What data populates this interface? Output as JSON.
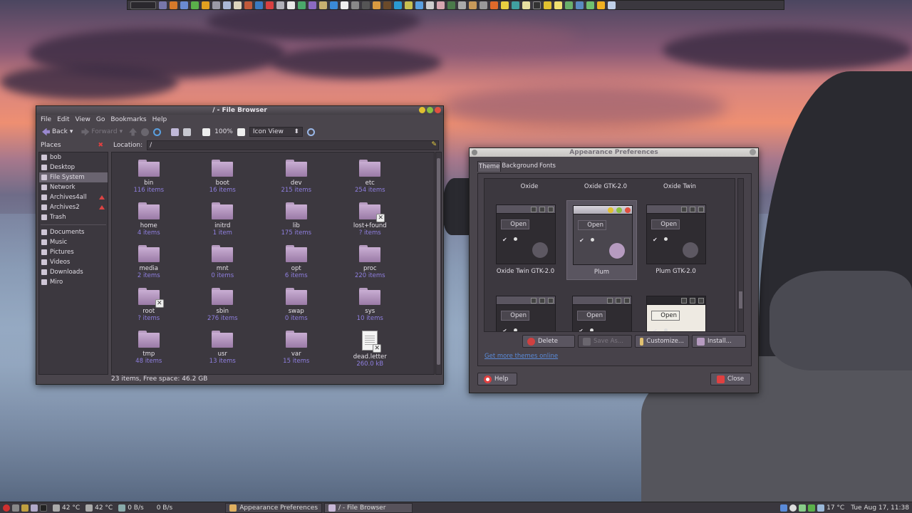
{
  "panel_top": {
    "launcher_icons": [
      "panel-menu-icon",
      "terminal-icon",
      "browser-icon",
      "mail-icon",
      "chat-icon",
      "music-icon",
      "settings-icon",
      "search-icon",
      "file-icon",
      "photo-icon",
      "video-icon",
      "game-icon",
      "calculator-icon",
      "calendar-icon",
      "network-icon",
      "chart-icon",
      "folder-icon",
      "trash-icon"
    ]
  },
  "file_browser": {
    "title": "/ - File Browser",
    "menus": [
      "File",
      "Edit",
      "View",
      "Go",
      "Bookmarks",
      "Help"
    ],
    "toolbar": {
      "back": "Back",
      "forward": "Forward",
      "zoom": "100%",
      "view_mode": "Icon View"
    },
    "places_label": "Places",
    "location_label": "Location:",
    "location_value": "/",
    "places": [
      {
        "label": "bob"
      },
      {
        "label": "Desktop"
      },
      {
        "label": "File System",
        "selected": true
      },
      {
        "label": "Network"
      },
      {
        "label": "Archives4all",
        "eject": true
      },
      {
        "label": "Archives2",
        "eject": true
      },
      {
        "label": "Trash"
      }
    ],
    "bookmarks": [
      {
        "label": "Documents"
      },
      {
        "label": "Music"
      },
      {
        "label": "Pictures"
      },
      {
        "label": "Videos"
      },
      {
        "label": "Downloads"
      },
      {
        "label": "Miro"
      }
    ],
    "items": [
      {
        "name": "bin",
        "info": "116 items"
      },
      {
        "name": "boot",
        "info": "16 items"
      },
      {
        "name": "dev",
        "info": "215 items"
      },
      {
        "name": "etc",
        "info": "254 items"
      },
      {
        "name": "home",
        "info": "4 items"
      },
      {
        "name": "initrd",
        "info": "1 item"
      },
      {
        "name": "lib",
        "info": "175 items"
      },
      {
        "name": "lost+found",
        "info": "? items"
      },
      {
        "name": "media",
        "info": "2 items"
      },
      {
        "name": "mnt",
        "info": "0 items"
      },
      {
        "name": "opt",
        "info": "6 items"
      },
      {
        "name": "proc",
        "info": "220 items"
      },
      {
        "name": "root",
        "info": "? items"
      },
      {
        "name": "sbin",
        "info": "276 items"
      },
      {
        "name": "swap",
        "info": "0 items"
      },
      {
        "name": "sys",
        "info": "10 items"
      },
      {
        "name": "tmp",
        "info": "48 items"
      },
      {
        "name": "usr",
        "info": "13 items"
      },
      {
        "name": "var",
        "info": "15 items"
      },
      {
        "name": "dead.letter",
        "info": "260.0 kB"
      }
    ],
    "status": "23 items, Free space: 46.2 GB"
  },
  "appearance": {
    "title": "Appearance Preferences",
    "tabs": [
      "Theme",
      "Background",
      "Fonts"
    ],
    "column_heads": [
      "Oxide",
      "Oxide GTK-2.0",
      "Oxide Twin"
    ],
    "themes": [
      {
        "name": "Oxide Twin GTK-2.0",
        "open": "Open"
      },
      {
        "name": "Plum",
        "open": "Open",
        "selected": true
      },
      {
        "name": "Plum GTK-2.0",
        "open": "Open"
      },
      {
        "name": "",
        "open": "Open"
      },
      {
        "name": "",
        "open": "Open"
      },
      {
        "name": "",
        "open": "Open"
      }
    ],
    "buttons": {
      "delete": "Delete",
      "save_as": "Save As...",
      "customize": "Customize...",
      "install": "Install..."
    },
    "link": "Get more themes online",
    "help": "Help",
    "close": "Close"
  },
  "panel_bottom": {
    "cpu_temp1": "42 °C",
    "cpu_temp2": "42 °C",
    "net_down": "0 B/s",
    "net_up": "0 B/s",
    "tasks": [
      "Appearance Preferences",
      "/ - File Browser"
    ],
    "weather": "17 °C",
    "clock": "Tue Aug 17, 11:38"
  }
}
